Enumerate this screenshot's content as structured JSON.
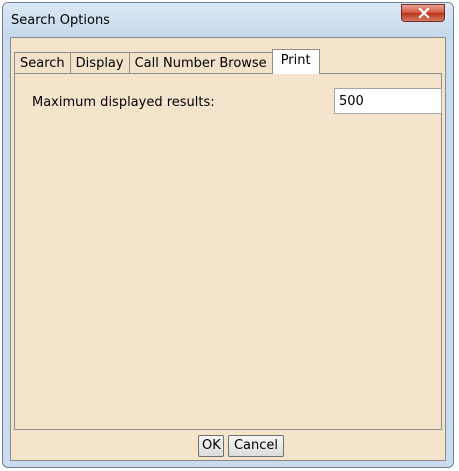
{
  "window": {
    "title": "Search Options",
    "close_icon": "close-icon"
  },
  "tabs": [
    {
      "label": "Search",
      "active": false
    },
    {
      "label": "Display",
      "active": false
    },
    {
      "label": "Call Number Browse",
      "active": false
    },
    {
      "label": "Print",
      "active": true
    }
  ],
  "print_tab": {
    "max_results_label": "Maximum displayed results:",
    "max_results_value": "500"
  },
  "buttons": {
    "ok_label": "OK",
    "cancel_label": "Cancel"
  },
  "colors": {
    "client_bg": "#f5e4cc",
    "close_button": "#c9462c",
    "titlebar": "#c9dbee"
  }
}
